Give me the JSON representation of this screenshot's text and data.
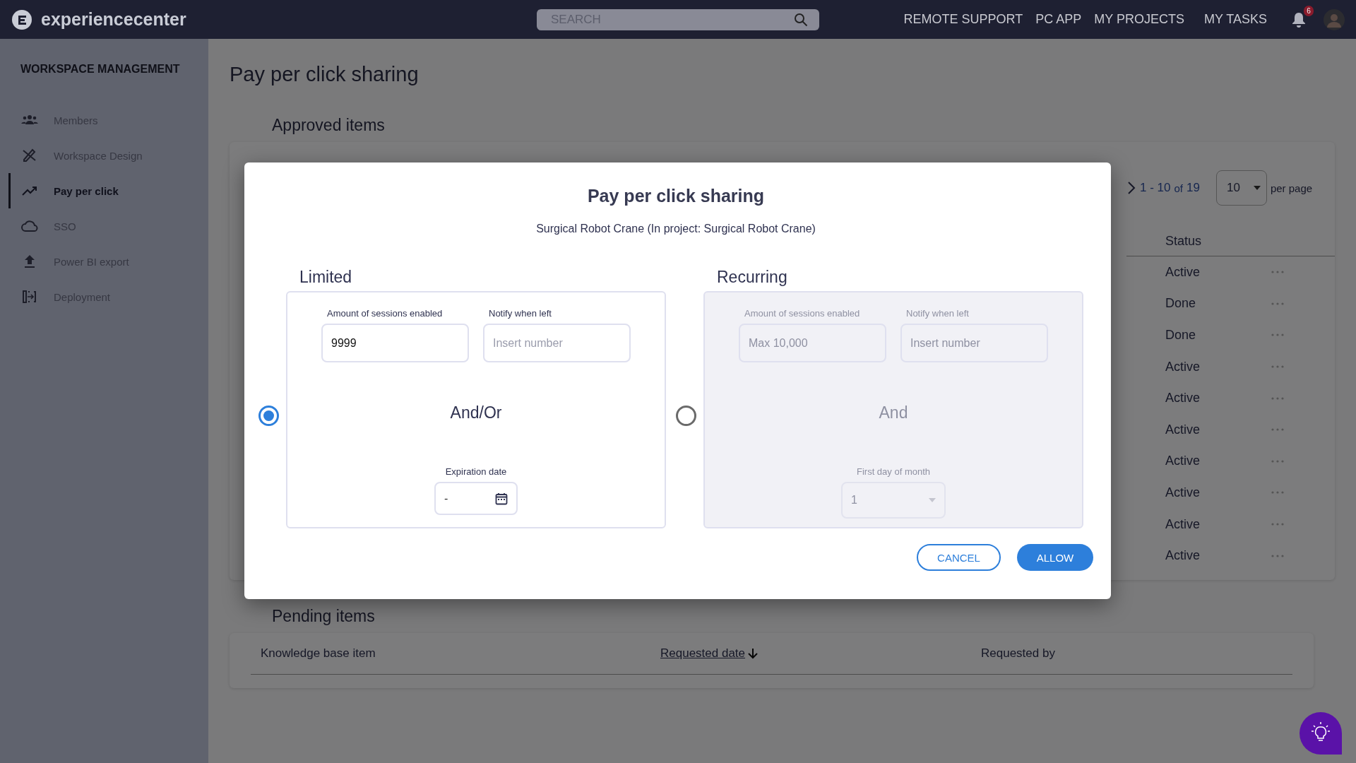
{
  "topbar": {
    "brand": "experiencecenter",
    "search": {
      "placeholder": "SEARCH"
    },
    "nav": [
      "REMOTE SUPPORT",
      "PC APP",
      "MY PROJECTS",
      "MY TASKS"
    ],
    "notifications": "6"
  },
  "sidebar": {
    "heading": "WORKSPACE MANAGEMENT",
    "items": [
      {
        "label": "Members",
        "selected": false
      },
      {
        "label": "Workspace Design",
        "selected": false
      },
      {
        "label": "Pay per click",
        "selected": true
      },
      {
        "label": "SSO",
        "selected": false
      },
      {
        "label": "Power BI export",
        "selected": false
      },
      {
        "label": "Deployment",
        "selected": false
      }
    ]
  },
  "page_title": "Pay per click sharing",
  "approved": {
    "title": "Approved items",
    "pagination": {
      "range": "1 - 10",
      "of": "of",
      "total": "19",
      "per_page": "10",
      "per_page_label": "per page"
    },
    "column": "Status",
    "rows": [
      {
        "status": "Active"
      },
      {
        "status": "Done"
      },
      {
        "status": "Done"
      },
      {
        "status": "Active"
      },
      {
        "status": "Active"
      },
      {
        "status": "Active"
      },
      {
        "status": "Active"
      },
      {
        "status": "Active"
      },
      {
        "status": "Active"
      },
      {
        "status": "Active"
      }
    ]
  },
  "pending": {
    "title": "Pending items",
    "columns": [
      {
        "label": "Knowledge base item",
        "sorted": false
      },
      {
        "label": "Requested date",
        "sorted": true
      },
      {
        "label": "Requested by",
        "sorted": false
      }
    ]
  },
  "modal": {
    "title": "Pay per click sharing",
    "subtitle": "Surgical Robot Crane (In project: Surgical Robot Crane)",
    "options": [
      {
        "kind": "limited",
        "title": "Limited",
        "selected": true,
        "disabled": false,
        "fields": [
          {
            "label": "Amount of sessions enabled",
            "value": "9999"
          },
          {
            "label": "Notify when left",
            "placeholder": "Insert number"
          }
        ],
        "connector": "And/Or",
        "bottom": {
          "label": "Expiration date",
          "value": "-"
        }
      },
      {
        "kind": "recurring",
        "title": "Recurring",
        "selected": false,
        "disabled": true,
        "fields": [
          {
            "label": "Amount of sessions enabled",
            "placeholder": "Max 10,000"
          },
          {
            "label": "Notify when left",
            "placeholder": "Insert number"
          }
        ],
        "connector": "And",
        "bottom": {
          "label": "First day of month",
          "value": "1"
        }
      }
    ],
    "buttons": [
      {
        "label": "CANCEL",
        "kind": "outline"
      },
      {
        "label": "ALLOW",
        "kind": "primary"
      }
    ]
  }
}
